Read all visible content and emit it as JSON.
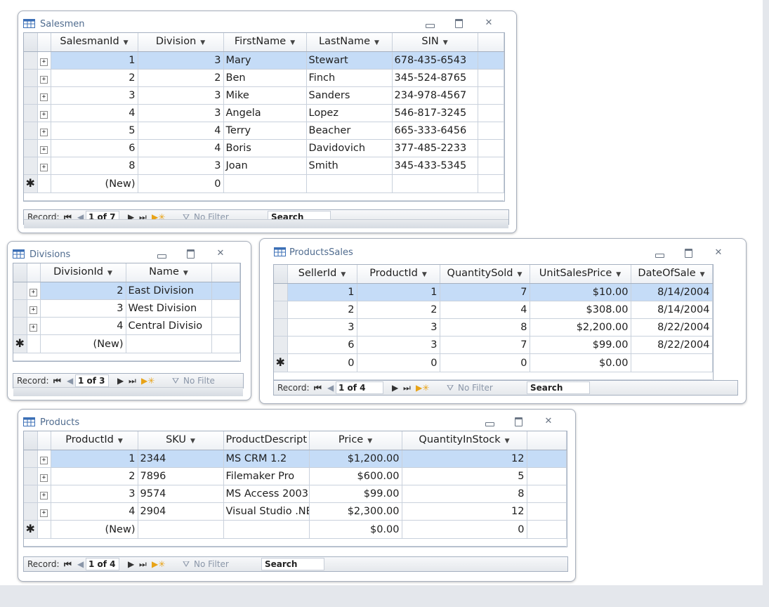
{
  "windows": {
    "salesmen": {
      "title": "Salesmen",
      "headers": [
        "SalesmanId",
        "Division",
        "FirstName",
        "LastName",
        "SIN"
      ],
      "rows": [
        [
          "1",
          "3",
          "Mary",
          "Stewart",
          "678-435-6543"
        ],
        [
          "2",
          "2",
          "Ben",
          "Finch",
          "345-524-8765"
        ],
        [
          "3",
          "3",
          "Mike",
          "Sanders",
          "234-978-4567"
        ],
        [
          "4",
          "3",
          "Angela",
          "Lopez",
          "546-817-3245"
        ],
        [
          "5",
          "4",
          "Terry",
          "Beacher",
          "665-333-6456"
        ],
        [
          "6",
          "4",
          "Boris",
          "Davidovich",
          "377-485-2233"
        ],
        [
          "8",
          "3",
          "Joan",
          "Smith",
          "345-433-5345"
        ]
      ],
      "new_row": [
        "(New)",
        "0",
        "",
        "",
        ""
      ],
      "nav": {
        "label": "Record:",
        "record": "1 of 7",
        "filter": "No Filter",
        "search": "Search"
      }
    },
    "divisions": {
      "title": "Divisions",
      "headers": [
        "DivisionId",
        "Name"
      ],
      "rows": [
        [
          "2",
          "East Division"
        ],
        [
          "3",
          "West Division"
        ],
        [
          "4",
          "Central Divisio"
        ]
      ],
      "new_row": [
        "(New)",
        ""
      ],
      "nav": {
        "label": "Record:",
        "record": "1 of 3",
        "filter": "No Filte"
      }
    },
    "products_sales": {
      "title": "ProductsSales",
      "headers": [
        "SellerId",
        "ProductId",
        "QuantitySold",
        "UnitSalesPrice",
        "DateOfSale"
      ],
      "rows": [
        [
          "1",
          "1",
          "7",
          "$10.00",
          "8/14/2004"
        ],
        [
          "2",
          "2",
          "4",
          "$308.00",
          "8/14/2004"
        ],
        [
          "3",
          "3",
          "8",
          "$2,200.00",
          "8/22/2004"
        ],
        [
          "6",
          "3",
          "7",
          "$99.00",
          "8/22/2004"
        ]
      ],
      "new_row": [
        "0",
        "0",
        "0",
        "$0.00",
        ""
      ],
      "nav": {
        "label": "Record:",
        "record": "1 of 4",
        "filter": "No Filter",
        "search": "Search"
      }
    },
    "products": {
      "title": "Products",
      "headers": [
        "ProductId",
        "SKU",
        "ProductDescript",
        "Price",
        "QuantityInStock"
      ],
      "rows": [
        [
          "1",
          "2344",
          "MS CRM 1.2",
          "$1,200.00",
          "12"
        ],
        [
          "2",
          "7896",
          "Filemaker Pro",
          "$600.00",
          "5"
        ],
        [
          "3",
          "9574",
          "MS Access 2003",
          "$99.00",
          "8"
        ],
        [
          "4",
          "2904",
          "Visual Studio .NET",
          "$2,300.00",
          "12"
        ]
      ],
      "new_row": [
        "(New)",
        "",
        "",
        "$0.00",
        "0"
      ],
      "nav": {
        "label": "Record:",
        "record": "1 of 4",
        "filter": "No Filter",
        "search": "Search"
      }
    }
  },
  "colors": {
    "selected_row": "#c5dcf7",
    "title_text": "#4f6b8e",
    "accent_new_record": "#e8a317"
  },
  "icons": {
    "table": "table-icon",
    "minimize": "minimize-icon",
    "restore": "restore-icon",
    "close": "close-icon",
    "expand": "plus-expand-icon",
    "new_record": "asterisk-icon"
  }
}
